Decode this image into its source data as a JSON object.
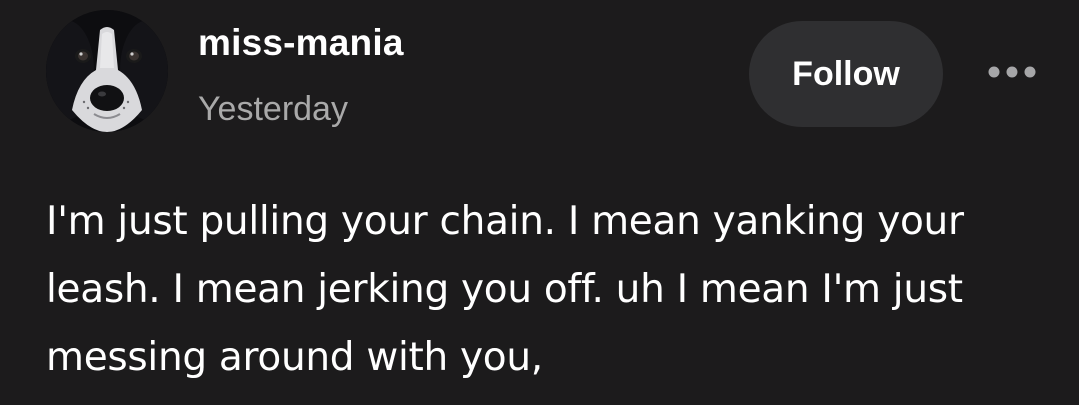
{
  "post": {
    "author": {
      "username": "miss-mania",
      "timestamp": "Yesterday",
      "avatar_icon": "dog-avatar-icon"
    },
    "actions": {
      "follow_label": "Follow",
      "more_icon": "ellipsis-icon"
    },
    "body": {
      "lines": [
        "I'm just pulling your chain. I mean yanking your",
        "leash. I mean jerking you off. uh I mean I'm just",
        "messing around with you,"
      ]
    }
  },
  "colors": {
    "background": "#1c1b1c",
    "follow_button_bg": "#2f2f31",
    "text_primary": "#ffffff",
    "text_secondary": "#a9a9a9"
  }
}
